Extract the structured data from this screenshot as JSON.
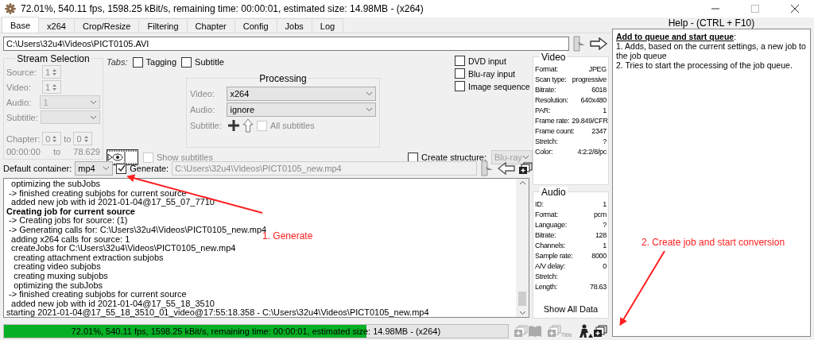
{
  "window": {
    "title": "72.01%, 540.11 fps, 1598.25 kBit/s, remaining time: 00:00:01, estimated size: 14.98MB - (x264)"
  },
  "tabs": [
    {
      "label": "Base",
      "selected": true
    },
    {
      "label": "x264",
      "selected": false
    },
    {
      "label": "Crop/Resize",
      "selected": false
    },
    {
      "label": "Filtering",
      "selected": false
    },
    {
      "label": "Chapter",
      "selected": false
    },
    {
      "label": "Config",
      "selected": false
    },
    {
      "label": "Jobs",
      "selected": false
    },
    {
      "label": "Log",
      "selected": false
    }
  ],
  "source_path": "C:\\Users\\32u4\\Videos\\PICT0105.AVI",
  "stream_selection": {
    "title": "Stream Selection",
    "source": {
      "label": "Source:",
      "value": "1"
    },
    "video": {
      "label": "Video:",
      "value": "1"
    },
    "audio": {
      "label": "Audio:",
      "value": "1"
    },
    "subtitle": {
      "label": "Subtitle:"
    },
    "chapter": {
      "label": "Chapter:",
      "from": "0",
      "to_label": "to",
      "to": "0"
    },
    "time": {
      "start": "00:00:00",
      "to_label": "to",
      "end": "78.629"
    }
  },
  "tab_options": {
    "label": "Tabs:",
    "items": [
      {
        "label": "Tagging",
        "checked": false
      },
      {
        "label": "Subtitle",
        "checked": false
      }
    ]
  },
  "input_options": [
    {
      "label": "DVD input",
      "checked": false
    },
    {
      "label": "Blu-ray input",
      "checked": false
    },
    {
      "label": "Image sequence",
      "checked": false
    }
  ],
  "processing": {
    "title": "Processing",
    "video": {
      "label": "Video:",
      "value": "x264"
    },
    "audio": {
      "label": "Audio:",
      "value": "ignore"
    },
    "subtitle": {
      "label": "Subtitle:",
      "all_subtitles": {
        "label": "All subtitles",
        "checked": false
      }
    }
  },
  "show_subtitles": {
    "label": "Show subtitles",
    "checked": false
  },
  "create_structure": {
    "label": "Create structure:",
    "checked": false,
    "value": "Blu-ray"
  },
  "default_container": {
    "label": "Default container:",
    "value": "mp4"
  },
  "generate": {
    "label": "Generate:",
    "checked": true,
    "path": "C:\\Users\\32u4\\Videos\\PICT0105_new.mp4"
  },
  "log": [
    {
      "kind": "line",
      "text": "  optimizing the subJobs"
    },
    {
      "kind": "line",
      "text": " -> finished creating subjobs for current source"
    },
    {
      "kind": "line",
      "text": "  added new job with id 2021-01-04@17_55_07_7710"
    },
    {
      "kind": "heading",
      "text": "Creating job for current source"
    },
    {
      "kind": "line",
      "text": " -> Creating jobs for source: (1)"
    },
    {
      "kind": "line",
      "text": " -> Generating calls for: C:\\Users\\32u4\\Videos\\PICT0105_new.mp4"
    },
    {
      "kind": "line",
      "text": "  adding x264 calls for source: 1"
    },
    {
      "kind": "line",
      "text": "  createJobs for C:\\Users\\32u4\\Videos\\PICT0105_new.mp4"
    },
    {
      "kind": "line",
      "text": "   creating attachment extraction subjobs"
    },
    {
      "kind": "line",
      "text": "   creating video subjobs"
    },
    {
      "kind": "line",
      "text": "   creating muxing subjobs"
    },
    {
      "kind": "line",
      "text": "   optimizing the subJobs"
    },
    {
      "kind": "line",
      "text": " -> finished creating subjobs for current source"
    },
    {
      "kind": "line",
      "text": "  added new job with id 2021-01-04@17_55_18_3510"
    },
    {
      "kind": "line",
      "text": "starting 2021-01-04@17_55_18_3510_01_video@17:55:18.358 - C:\\Users\\32u4\\Videos\\PICT0105_new.mp4"
    }
  ],
  "progress": {
    "level": 0.7201,
    "text": "72.01%, 540.11 fps, 1598.25 kBit/s, remaining time: 00:00:01, estimated size: 14.98MB - (x264)"
  },
  "title_icon_label": "Title",
  "video_info": {
    "title": "Video",
    "rows": [
      {
        "label": "Format:",
        "value": "JPEG"
      },
      {
        "label": "Scan type:",
        "value": "progressive"
      },
      {
        "label": "Bitrate:",
        "value": "6018"
      },
      {
        "label": "Resolution:",
        "value": "640x480"
      },
      {
        "label": "PAR:",
        "value": "1"
      },
      {
        "label": "Frame rate:",
        "value": "29.849/CFR"
      },
      {
        "label": "Frame count:",
        "value": "2347"
      },
      {
        "label": "Stretch:",
        "value": "?"
      },
      {
        "label": "Color:",
        "value": "4:2:2/8/pc"
      }
    ]
  },
  "audio_info": {
    "title": "Audio",
    "rows": [
      {
        "label": "ID:",
        "value": "1"
      },
      {
        "label": "Format:",
        "value": "pcm"
      },
      {
        "label": "Language:",
        "value": "?"
      },
      {
        "label": "Bitrate:",
        "value": "128"
      },
      {
        "label": "Channels:",
        "value": "1"
      },
      {
        "label": "Sample rate:",
        "value": "8000"
      },
      {
        "label": "A/V delay:",
        "value": "0"
      },
      {
        "label": "Stretch:"
      },
      {
        "label": "Length:",
        "value": "78.63"
      }
    ],
    "button": "Show All Data"
  },
  "help": {
    "title": "Help - (CTRL + F10)",
    "heading": "Add to queue and start queue",
    "heading_suffix": ":",
    "steps": [
      "1. Adds, based on the current settings,  a new job to the job queue",
      "2. Tries to start the processing of the job queue."
    ]
  },
  "annotations": [
    {
      "text": "1. Generate"
    },
    {
      "text": "2. Create job and start conversion"
    }
  ]
}
